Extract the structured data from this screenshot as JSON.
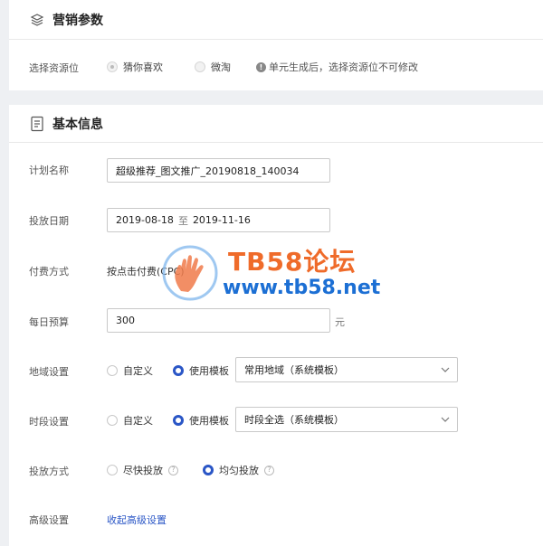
{
  "marketing": {
    "title": "营销参数",
    "resource_label": "选择资源位",
    "options": [
      {
        "label": "猜你喜欢",
        "checked": true
      },
      {
        "label": "微淘",
        "checked": false
      }
    ],
    "hint": "单元生成后，选择资源位不可修改"
  },
  "basic": {
    "title": "基本信息",
    "plan_name": {
      "label": "计划名称",
      "value": "超级推荐_图文推广_20190818_140034"
    },
    "date": {
      "label": "投放日期",
      "start": "2019-08-18",
      "separator": "至",
      "end": "2019-11-16"
    },
    "billing": {
      "label": "付费方式",
      "value": "按点击付费(CPC)"
    },
    "budget": {
      "label": "每日预算",
      "value": "300",
      "unit": "元"
    },
    "region": {
      "label": "地域设置",
      "custom": "自定义",
      "template": "使用模板",
      "selected": "常用地域（系统模板）"
    },
    "time": {
      "label": "时段设置",
      "custom": "自定义",
      "template": "使用模板",
      "selected": "时段全选（系统模板）"
    },
    "delivery": {
      "label": "投放方式",
      "fast": "尽快投放",
      "even": "均匀投放"
    },
    "advanced": {
      "label": "高级设置",
      "link": "收起高级设置"
    }
  },
  "watermark": {
    "title": "TB58论坛",
    "url": "www.tb58.net"
  },
  "colors": {
    "accent": "#2a56c6",
    "watermark_orange": "#ef6b2a",
    "watermark_blue": "#1c6fd4"
  }
}
